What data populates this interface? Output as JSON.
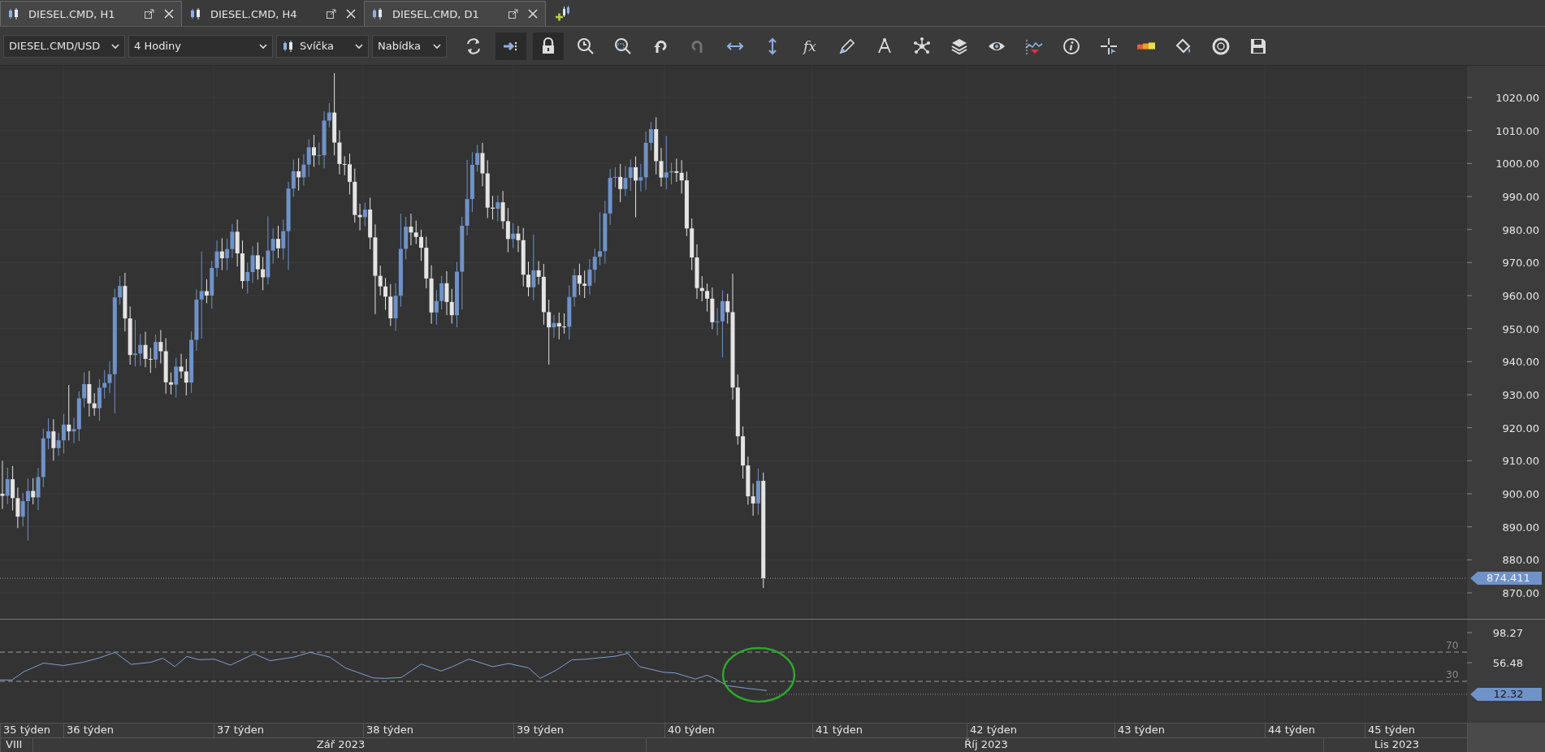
{
  "tabs": [
    {
      "label": "DIESEL.CMD, H1",
      "selected": false
    },
    {
      "label": "DIESEL.CMD, H4",
      "selected": true
    },
    {
      "label": "DIESEL.CMD, D1",
      "selected": false
    }
  ],
  "toolbar": {
    "dropdowns": [
      {
        "kind": "plain",
        "value": "DIESEL.CMD/USD"
      },
      {
        "kind": "plain",
        "value": "4 Hodiny"
      },
      {
        "kind": "candle",
        "value": "Svíčka"
      },
      {
        "kind": "plain",
        "value": "Nabídka"
      }
    ],
    "buttons": [
      {
        "pressed": false,
        "disabled": false
      },
      {
        "pressed": true,
        "disabled": false
      },
      {
        "pressed": true,
        "disabled": false
      },
      {
        "pressed": false,
        "disabled": false
      },
      {
        "pressed": false,
        "disabled": false
      },
      {
        "pressed": false,
        "disabled": false
      },
      {
        "pressed": false,
        "disabled": true
      },
      {
        "pressed": false,
        "disabled": false
      },
      {
        "pressed": false,
        "disabled": false
      },
      {
        "pressed": false,
        "disabled": false,
        "glyph": "fx"
      },
      {
        "pressed": false,
        "disabled": false
      },
      {
        "pressed": false,
        "disabled": false
      },
      {
        "pressed": false,
        "disabled": false
      },
      {
        "pressed": false,
        "disabled": false
      },
      {
        "pressed": false,
        "disabled": false
      },
      {
        "pressed": false,
        "disabled": false
      },
      {
        "pressed": false,
        "disabled": false
      },
      {
        "pressed": false,
        "disabled": false
      },
      {
        "pressed": false,
        "disabled": false
      },
      {
        "pressed": false,
        "disabled": false
      },
      {
        "pressed": false,
        "disabled": false
      },
      {
        "pressed": false,
        "disabled": false
      }
    ]
  },
  "price_panel": {
    "axis_labels": [
      "1020.00",
      "1010.00",
      "1000.00",
      "990.00",
      "980.00",
      "970.00",
      "960.00",
      "950.00",
      "940.00",
      "930.00",
      "920.00",
      "910.00",
      "900.00",
      "890.00",
      "880.00",
      "870.00"
    ],
    "current_price": "874.411"
  },
  "indicator_panel": {
    "axis_labels": [
      "98.27",
      "56.48"
    ],
    "current_value": "12.32",
    "levels": [
      "70",
      "30"
    ]
  },
  "time_axis": {
    "weeks": [
      "35 týden",
      "36 týden",
      "37 týden",
      "38 týden",
      "39 týden",
      "40 týden",
      "41 týden",
      "42 týden",
      "43 týden",
      "44 týden",
      "45 týden"
    ],
    "months": [
      "VIII",
      "Zář 2023",
      "Říj 2023",
      "Lis 2023"
    ]
  }
}
